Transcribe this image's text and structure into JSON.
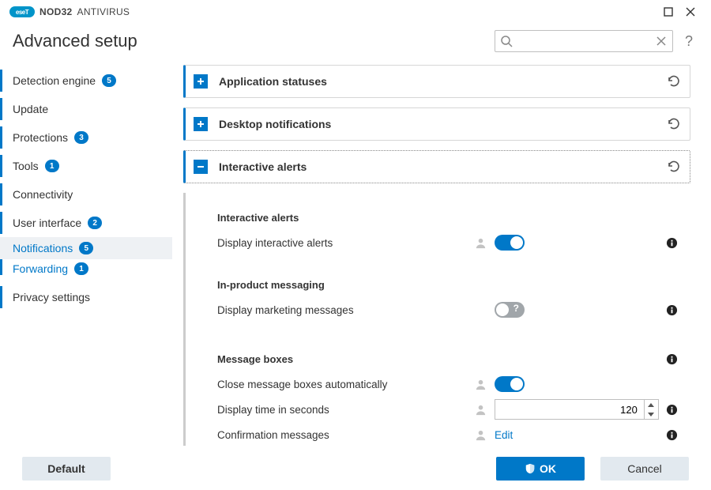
{
  "brand": {
    "logo_text": "eseT",
    "name1": "NOD32",
    "name2": "ANTIVIRUS"
  },
  "page_title": "Advanced setup",
  "search": {
    "value": "",
    "placeholder": ""
  },
  "sidebar": {
    "items": [
      {
        "label": "Detection engine",
        "badge": "5"
      },
      {
        "label": "Update",
        "badge": ""
      },
      {
        "label": "Protections",
        "badge": "3"
      },
      {
        "label": "Tools",
        "badge": "1"
      },
      {
        "label": "Connectivity",
        "badge": ""
      },
      {
        "label": "User interface",
        "badge": "2"
      },
      {
        "label": "Notifications",
        "badge": "5"
      },
      {
        "label": "Forwarding",
        "badge": "1"
      },
      {
        "label": "Privacy settings",
        "badge": ""
      }
    ]
  },
  "panels": {
    "app_statuses": {
      "title": "Application statuses"
    },
    "desktop_notifications": {
      "title": "Desktop notifications"
    },
    "interactive_alerts": {
      "title": "Interactive alerts",
      "section1_title": "Interactive alerts",
      "row_display_interactive": "Display interactive alerts",
      "section2_title": "In-product messaging",
      "row_display_marketing": "Display marketing messages",
      "section3_title": "Message boxes",
      "row_close_auto": "Close message boxes automatically",
      "row_display_time": "Display time in seconds",
      "display_time_value": "120",
      "row_confirmation": "Confirmation messages",
      "edit_label": "Edit"
    }
  },
  "footer": {
    "default": "Default",
    "ok": "OK",
    "cancel": "Cancel"
  }
}
